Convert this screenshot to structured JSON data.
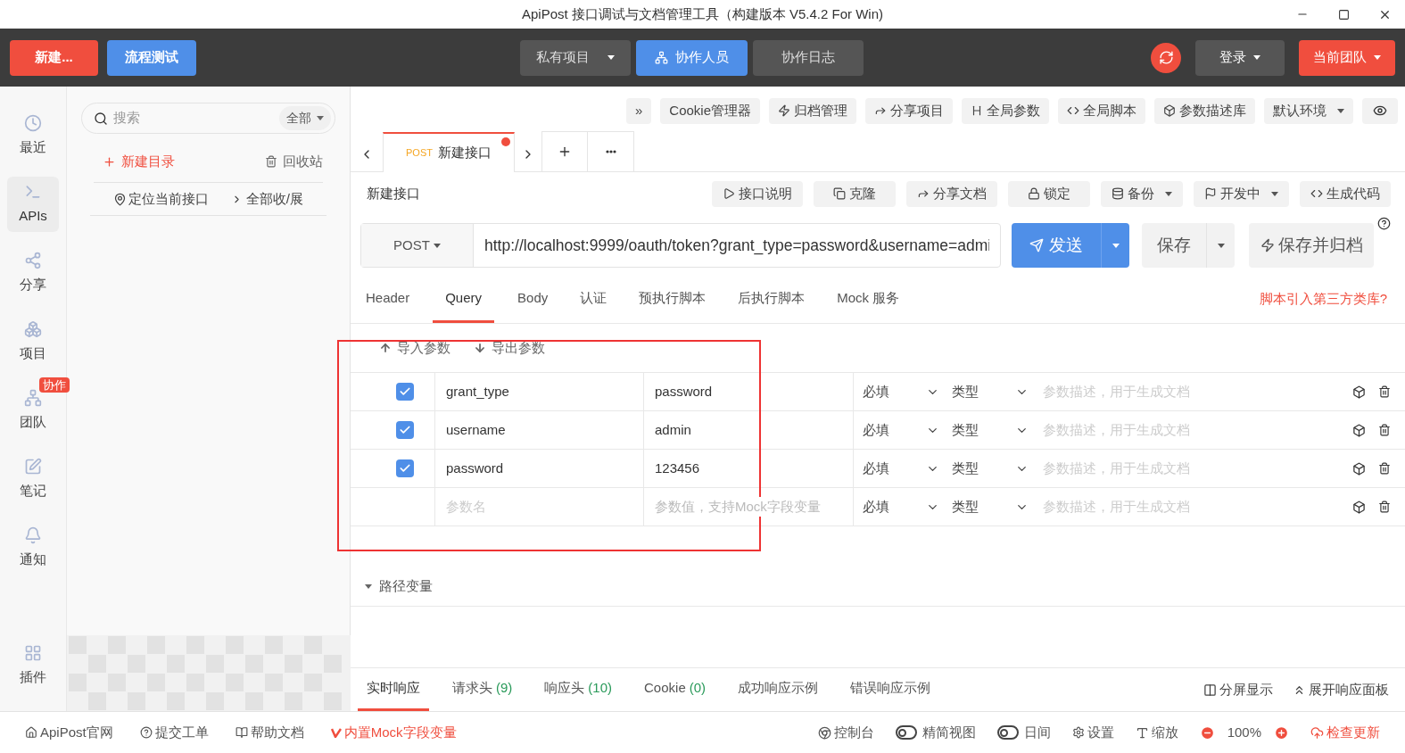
{
  "window": {
    "title": "ApiPost 接口调试与文档管理工具（构建版本 V5.4.2 For Win)"
  },
  "top_bar": {
    "left_buttons": [
      {
        "label": "新建...",
        "kind": "danger"
      },
      {
        "label": "流程测试",
        "kind": "primary"
      }
    ],
    "center_buttons": [
      {
        "label": "私有项目",
        "kind": "dropdown",
        "selected": false
      },
      {
        "label": "协作人员",
        "kind": "icon",
        "selected": true
      },
      {
        "label": "协作日志",
        "kind": "plain",
        "selected": false
      }
    ],
    "login": "登录",
    "team": "当前团队"
  },
  "rail": [
    {
      "label": "最近",
      "selected": false
    },
    {
      "label": "APIs",
      "selected": true
    },
    {
      "label": "分享",
      "selected": false
    },
    {
      "label": "项目",
      "selected": false
    },
    {
      "label": "团队",
      "selected": false,
      "badge": "协作"
    },
    {
      "label": "笔记",
      "selected": false
    },
    {
      "label": "通知",
      "selected": false
    }
  ],
  "rail_bottom": {
    "label": "插件"
  },
  "tree": {
    "search_placeholder": "搜索",
    "filter": "全部",
    "new_folder": "新建目录",
    "trash": "回收站",
    "locate": "定位当前接口",
    "toggle_all": "全部收/展"
  },
  "toolbar": [
    {
      "label": "»"
    },
    {
      "label": "Cookie管理器"
    },
    {
      "label": "归档管理"
    },
    {
      "label": "分享项目"
    },
    {
      "label": "全局参数"
    },
    {
      "label": "全局脚本"
    },
    {
      "label": "参数描述库"
    },
    {
      "label": "默认环境",
      "dropdown": true
    }
  ],
  "tabs": [
    {
      "method": "POST",
      "title": "新建接口",
      "selected": true,
      "modified": true
    }
  ],
  "request": {
    "name": "新建接口",
    "actions": [
      {
        "label": "接口说明"
      },
      {
        "label": "克隆"
      },
      {
        "label": "分享文档"
      },
      {
        "label": "锁定"
      },
      {
        "label": "备份",
        "dropdown": true
      },
      {
        "label": "开发中",
        "dropdown": true
      },
      {
        "label": "生成代码"
      }
    ],
    "method": "POST",
    "url": "http://localhost:9999/oauth/token?grant_type=password&username=admi",
    "send": "发送",
    "save": "保存",
    "save_archive": "保存并归档"
  },
  "param_tabs": [
    {
      "label": "Header",
      "selected": false
    },
    {
      "label": "Query",
      "selected": true
    },
    {
      "label": "Body",
      "selected": false
    },
    {
      "label": "认证",
      "selected": false
    },
    {
      "label": "预执行脚本",
      "selected": false
    },
    {
      "label": "后执行脚本",
      "selected": false
    },
    {
      "label": "Mock 服务",
      "selected": false
    }
  ],
  "script_link": "脚本引入第三方类库?",
  "import": "导入参数",
  "export": "导出参数",
  "params": [
    {
      "kind": "param",
      "checked": true,
      "key": "grant_type",
      "value": "password",
      "required": "必填",
      "type": "类型",
      "description_placeholder": "参数描述，用于生成文档"
    },
    {
      "kind": "param",
      "checked": true,
      "key": "username",
      "value": "admin",
      "required": "必填",
      "type": "类型",
      "description_placeholder": "参数描述，用于生成文档"
    },
    {
      "kind": "param",
      "checked": true,
      "key": "password",
      "value": "123456",
      "required": "必填",
      "type": "类型",
      "description_placeholder": "参数描述，用于生成文档"
    },
    {
      "kind": "new",
      "key_placeholder": "参数名",
      "value_placeholder": "参数值，支持Mock字段变量",
      "required": "必填",
      "type": "类型",
      "description_placeholder": "参数描述，用于生成文档"
    }
  ],
  "path_vars": {
    "label": "路径变量",
    "expanded": true
  },
  "response_tabs": [
    {
      "label": "实时响应",
      "selected": true
    },
    {
      "label": "请求头",
      "count": "(9)",
      "selected": false
    },
    {
      "label": "响应头",
      "count": "(10)",
      "selected": false
    },
    {
      "label": "Cookie",
      "count": "(0)",
      "selected": false
    },
    {
      "label": "成功响应示例",
      "selected": false
    },
    {
      "label": "错误响应示例",
      "selected": false
    }
  ],
  "response_actions": [
    "分屏显示",
    "展开响应面板"
  ],
  "status_bar": {
    "left": [
      {
        "label": "ApiPost官网",
        "kind": "plain"
      },
      {
        "label": "提交工单",
        "kind": "plain"
      },
      {
        "label": "帮助文档",
        "kind": "plain"
      },
      {
        "label": "内置Mock字段变量",
        "kind": "accent"
      }
    ],
    "console": "控制台",
    "toggles": [
      {
        "label": "精简视图",
        "on": false
      },
      {
        "label": "日间",
        "on": false
      }
    ],
    "settings": "设置",
    "zoom_label": "缩放",
    "zoom_value": "100%",
    "update": "检查更新"
  }
}
